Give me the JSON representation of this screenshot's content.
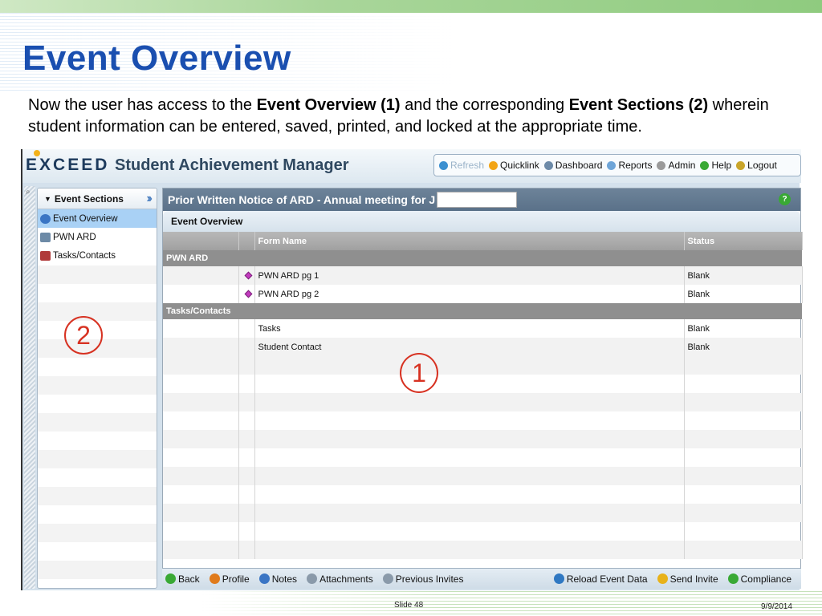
{
  "slide": {
    "title": "Event Overview",
    "intro": {
      "p1": "Now the user has access to the ",
      "b1": "Event Overview (1)",
      "p2": " and the corresponding ",
      "b2": "Event Sections (2)",
      "p3": " wherein student information can be entered, saved, printed, and locked at the appropriate time."
    },
    "slide_number": "Slide 48",
    "date": "9/9/2014"
  },
  "app": {
    "logo": "E CEED",
    "logo_x": "X",
    "name": "Student Achievement Manager",
    "topnav": [
      {
        "label": "Refresh",
        "icon": "refresh-icon",
        "color": "#3a8fd0",
        "disabled": true
      },
      {
        "label": "Quicklink",
        "icon": "quicklink-icon",
        "color": "#f2a516"
      },
      {
        "label": "Dashboard",
        "icon": "dashboard-icon",
        "color": "#6c8aa8"
      },
      {
        "label": "Reports",
        "icon": "reports-icon",
        "color": "#6ea5d8"
      },
      {
        "label": "Admin",
        "icon": "admin-gear-icon",
        "color": "#9a9a9a"
      },
      {
        "label": "Help",
        "icon": "help-icon",
        "color": "#39a935"
      },
      {
        "label": "Logout",
        "icon": "logout-icon",
        "color": "#c9a52a"
      }
    ]
  },
  "sections": {
    "header": "Event Sections",
    "items": [
      {
        "label": "Event Overview",
        "icon": "event-overview-icon",
        "active": true
      },
      {
        "label": "PWN ARD",
        "icon": "form-icon"
      },
      {
        "label": "Tasks/Contacts",
        "icon": "tasks-icon"
      }
    ]
  },
  "main": {
    "title": "Prior Written Notice of ARD -  Annual meeting for J",
    "subtitle": "Event Overview",
    "columns": {
      "form_name": "Form Name",
      "status": "Status"
    },
    "groups": [
      {
        "name": "PWN ARD",
        "rows": [
          {
            "form": "PWN ARD pg 1",
            "status": "Blank",
            "marker": true
          },
          {
            "form": "PWN ARD pg 2",
            "status": "Blank",
            "marker": true
          }
        ]
      },
      {
        "name": "Tasks/Contacts",
        "rows": [
          {
            "form": "Tasks",
            "status": "Blank",
            "marker": false
          },
          {
            "form": "Student Contact",
            "status": "Blank",
            "marker": false
          }
        ]
      }
    ]
  },
  "toolbar": {
    "left": [
      {
        "label": "Back",
        "icon": "back-arrow-icon",
        "color": "#39a935"
      },
      {
        "label": "Profile",
        "icon": "profile-icon",
        "color": "#e07b1c"
      },
      {
        "label": "Notes",
        "icon": "notes-icon",
        "color": "#3a75c4"
      },
      {
        "label": "Attachments",
        "icon": "attachments-icon",
        "color": "#8a9aaa"
      },
      {
        "label": "Previous Invites",
        "icon": "previous-invites-icon",
        "color": "#8a9aaa"
      }
    ],
    "right": [
      {
        "label": "Reload Event Data",
        "icon": "reload-icon",
        "color": "#2f78c2"
      },
      {
        "label": "Send Invite",
        "icon": "lock-icon",
        "color": "#e8b21a"
      },
      {
        "label": "Compliance",
        "icon": "check-icon",
        "color": "#39a935"
      }
    ]
  },
  "callouts": {
    "one": "1",
    "two": "2"
  }
}
